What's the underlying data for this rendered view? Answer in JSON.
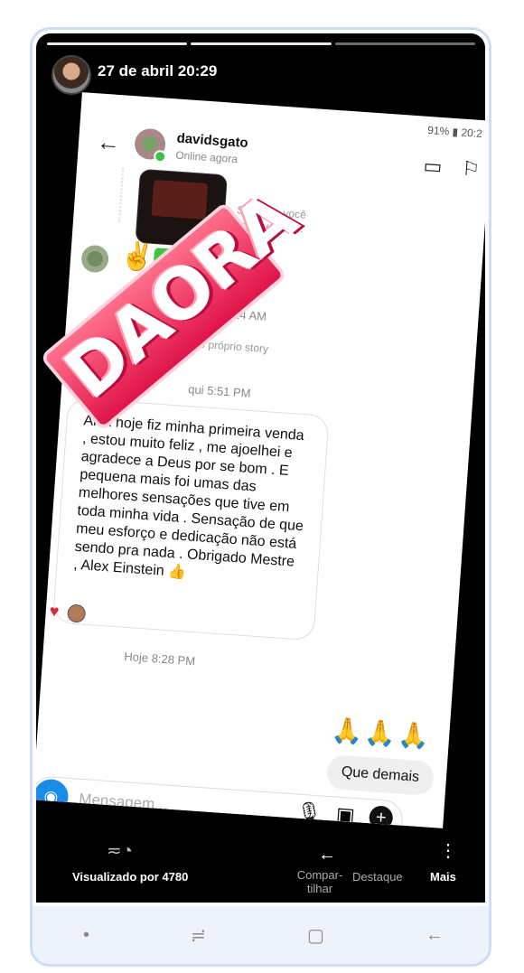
{
  "story": {
    "time": "27 de abril 20:29",
    "viewed_label": "Visualizado por 4780",
    "footer": {
      "share_label": "Compar-\ntilhar",
      "highlight_label": "Destaque",
      "more_label": "Mais"
    },
    "sticker_text": "DAORA"
  },
  "screenshot": {
    "status": "91% ▮ 20:2",
    "username": "davidsgato",
    "online": "Online agora",
    "only_you": "Somente você\npode ver isso.",
    "time1": "qui 10:24 AM",
    "reply_note": "nou você no próprio story",
    "time2": "qui 5:51 PM",
    "message": "Alex hoje fiz minha primeira venda ,  estou muito feliz , me ajoelhei e agradece a Deus por se bom . E pequena mais foi umas das melhores sensações que tive em toda minha vida . Sensação de que meu esforço e dedicação não está sendo pra nada . Obrigado Mestre , Alex Einstein 👍",
    "time3": "Hoje 8:28 PM",
    "pray_emojis": "🙏🙏🙏",
    "reply_bubble": "Que demais",
    "composer_placeholder": "Mensagem...",
    "signal_badge": "ıııl"
  },
  "icons": {
    "back": "arrow-left",
    "video": "video-icon",
    "flag": "flag-icon",
    "camera": "camera-icon",
    "mic": "mic-icon",
    "gallery": "image-icon",
    "plus": "plus-icon"
  }
}
